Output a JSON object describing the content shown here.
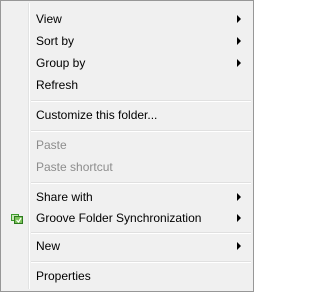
{
  "menu": {
    "view": "View",
    "sort_by": "Sort by",
    "group_by": "Group by",
    "refresh": "Refresh",
    "customize": "Customize this folder...",
    "paste": "Paste",
    "paste_shortcut": "Paste shortcut",
    "share_with": "Share with",
    "groove": "Groove Folder Synchronization",
    "new": "New",
    "properties": "Properties"
  },
  "icons": {
    "groove": "groove-sync-icon",
    "submenu": "submenu-arrow-icon"
  },
  "colors": {
    "menu_bg": "#f0f0f0",
    "border": "#979797",
    "disabled_text": "#8d8d8d",
    "groove_green": "#3a9a2a"
  }
}
